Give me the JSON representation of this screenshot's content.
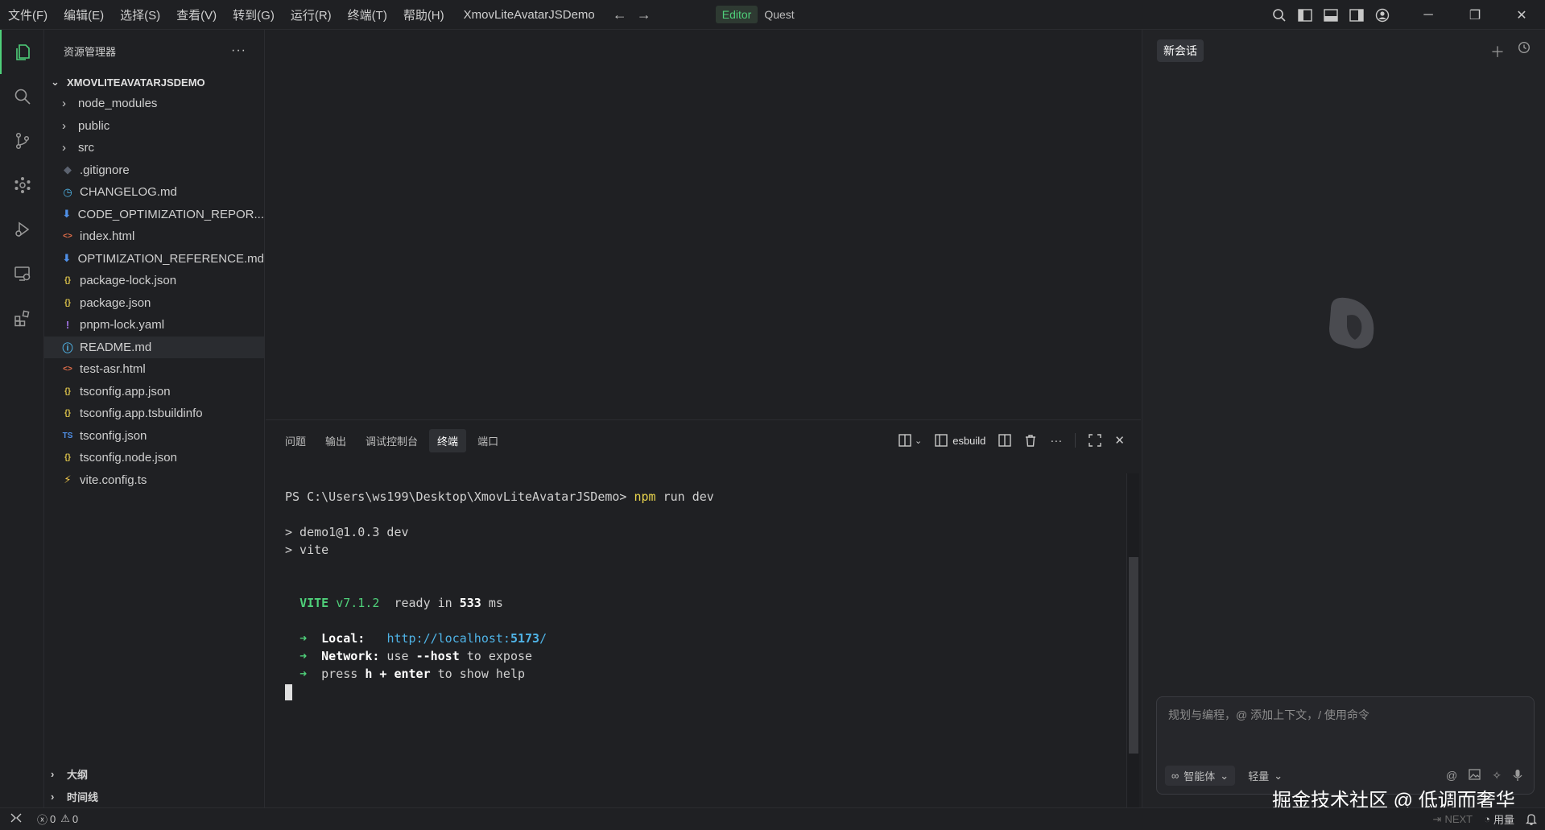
{
  "titlebar": {
    "menus": [
      "文件(F)",
      "编辑(E)",
      "选择(S)",
      "查看(V)",
      "转到(G)",
      "运行(R)",
      "终端(T)",
      "帮助(H)"
    ],
    "app_title": "XmovLiteAvatarJSDemo",
    "mode_editor": "Editor",
    "mode_quest": "Quest"
  },
  "sidebar": {
    "title": "资源管理器",
    "more": "···",
    "project": "XMOVLITEAVATARJSDEMO",
    "folders": [
      {
        "name": "node_modules"
      },
      {
        "name": "public"
      },
      {
        "name": "src"
      }
    ],
    "files": [
      {
        "name": ".gitignore",
        "icon": "git-icon",
        "glyph": "◆",
        "color": "#5c6370"
      },
      {
        "name": "CHANGELOG.md",
        "icon": "clock-icon",
        "glyph": "◷",
        "color": "#4fb3e6"
      },
      {
        "name": "CODE_OPTIMIZATION_REPOR...",
        "icon": "markdown-icon",
        "glyph": "⬇",
        "color": "#4f8fe6"
      },
      {
        "name": "index.html",
        "icon": "html-icon",
        "glyph": "<>",
        "color": "#e8704a"
      },
      {
        "name": "OPTIMIZATION_REFERENCE.md",
        "icon": "markdown-icon",
        "glyph": "⬇",
        "color": "#4f8fe6"
      },
      {
        "name": "package-lock.json",
        "icon": "json-icon",
        "glyph": "{}",
        "color": "#d9c04a"
      },
      {
        "name": "package.json",
        "icon": "json-icon",
        "glyph": "{}",
        "color": "#d9c04a"
      },
      {
        "name": "pnpm-lock.yaml",
        "icon": "yaml-icon",
        "glyph": "!",
        "color": "#a274e6"
      },
      {
        "name": "README.md",
        "icon": "info-icon",
        "glyph": "ⓘ",
        "color": "#4fb3e6"
      },
      {
        "name": "test-asr.html",
        "icon": "html-icon",
        "glyph": "<>",
        "color": "#e8704a"
      },
      {
        "name": "tsconfig.app.json",
        "icon": "json-icon",
        "glyph": "{}",
        "color": "#d9c04a"
      },
      {
        "name": "tsconfig.app.tsbuildinfo",
        "icon": "json-icon",
        "glyph": "{}",
        "color": "#d9c04a"
      },
      {
        "name": "tsconfig.json",
        "icon": "ts-icon",
        "glyph": "TS",
        "color": "#4f8fe6"
      },
      {
        "name": "tsconfig.node.json",
        "icon": "json-icon",
        "glyph": "{}",
        "color": "#d9c04a"
      },
      {
        "name": "vite.config.ts",
        "icon": "vite-icon",
        "glyph": "⚡",
        "color": "#f2c94c"
      }
    ],
    "selected_file": "README.md",
    "outline": "大纲",
    "timeline": "时间线"
  },
  "panel": {
    "tabs": [
      "问题",
      "输出",
      "调试控制台",
      "终端",
      "端口"
    ],
    "active_tab": "终端",
    "terminal_name": "esbuild",
    "terminal": {
      "prompt": "PS C:\\Users\\ws199\\Desktop\\XmovLiteAvatarJSDemo>",
      "command_npm": "npm",
      "command_rest": " run dev",
      "line_demo": "> demo1@1.0.3 dev",
      "line_vite": "> vite",
      "vite_label": "VITE",
      "vite_version": "v7.1.2",
      "ready_text": "ready in",
      "ready_ms": "533",
      "ms": "ms",
      "arrow": "➜",
      "local_label": "Local:",
      "local_url_prefix": "http://localhost:",
      "local_port": "5173",
      "local_url_suffix": "/",
      "network_label": "Network:",
      "network_use": " use ",
      "network_flag": "--host",
      "network_rest": " to expose",
      "press": "press ",
      "press_keys": "h + enter",
      "press_rest": " to show help"
    }
  },
  "chat": {
    "tab": "新会话",
    "placeholder": "规划与编程，@ 添加上下文，/ 使用命令",
    "agent_label": "智能体",
    "model_label": "轻量"
  },
  "watermark": "掘金技术社区 @ 低调而奢华",
  "statusbar": {
    "errors": "0",
    "warnings": "0",
    "next": "NEXT",
    "usage": "用量"
  }
}
